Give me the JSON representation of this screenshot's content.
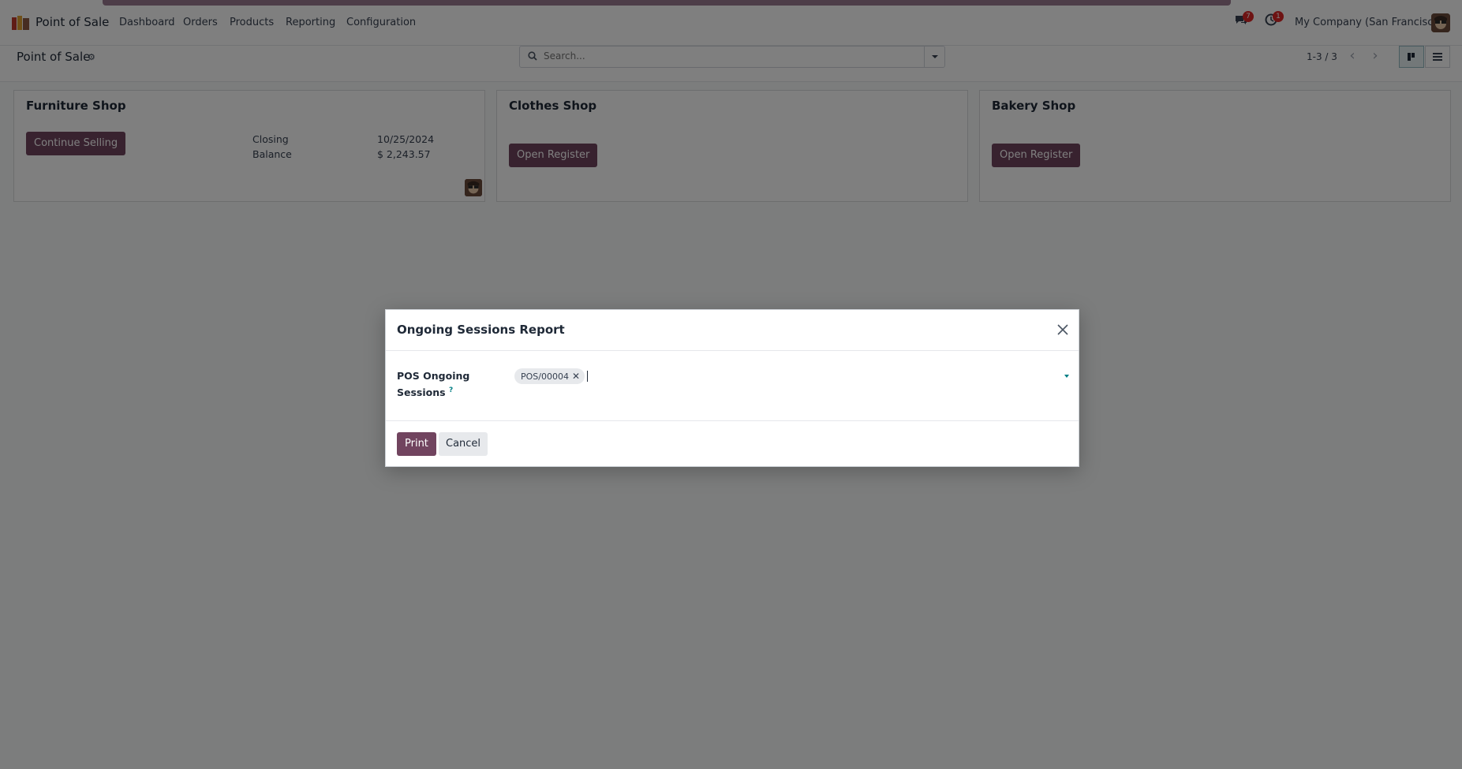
{
  "navbar": {
    "app_name": "Point of Sale",
    "menu": [
      "Dashboard",
      "Orders",
      "Products",
      "Reporting",
      "Configuration"
    ],
    "messages_count": "7",
    "activities_count": "1",
    "company": "My Company (San Francisco)"
  },
  "control_panel": {
    "breadcrumb": "Point of Sale",
    "search_placeholder": "Search...",
    "pager": "1-3 / 3"
  },
  "cards": [
    {
      "title": "Furniture Shop",
      "button": "Continue Selling",
      "closing_label": "Closing",
      "closing_value": "10/25/2024",
      "balance_label": "Balance",
      "balance_value": "$ 2,243.57"
    },
    {
      "title": "Clothes Shop",
      "button": "Open Register"
    },
    {
      "title": "Bakery Shop",
      "button": "Open Register"
    }
  ],
  "dialog": {
    "title": "Ongoing Sessions Report",
    "field_label": "POS Ongoing Sessions",
    "help_marker": "?",
    "tags": [
      "POS/00004"
    ],
    "print_label": "Print",
    "cancel_label": "Cancel"
  },
  "colors": {
    "primary": "#71445f",
    "accent": "#017e84",
    "badge": "#dc2626"
  }
}
